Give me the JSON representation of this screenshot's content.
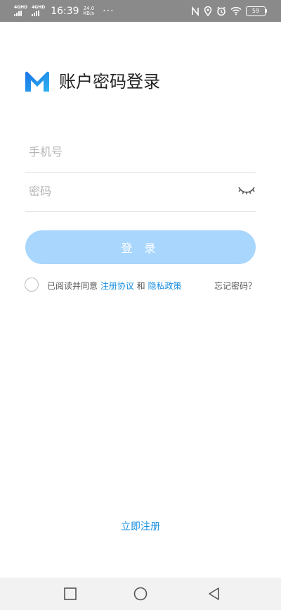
{
  "status_bar": {
    "network1": "4GHD",
    "network2": "4GHD",
    "time": "16:39",
    "speed_value": "24.0",
    "speed_unit": "KB/s",
    "more": "···",
    "battery": "59"
  },
  "header": {
    "title": "账户密码登录",
    "logo_color": "#1a73e8"
  },
  "form": {
    "phone_placeholder": "手机号",
    "password_placeholder": "密码",
    "login_label": "登 录"
  },
  "agreement": {
    "prefix": "已阅读并同意 ",
    "terms": "注册协议",
    "and": " 和 ",
    "privacy": "隐私政策",
    "forgot": "忘记密码？"
  },
  "footer": {
    "register": "立即注册"
  },
  "colors": {
    "accent": "#1a8fe0",
    "button_disabled": "#a8d6fd"
  }
}
